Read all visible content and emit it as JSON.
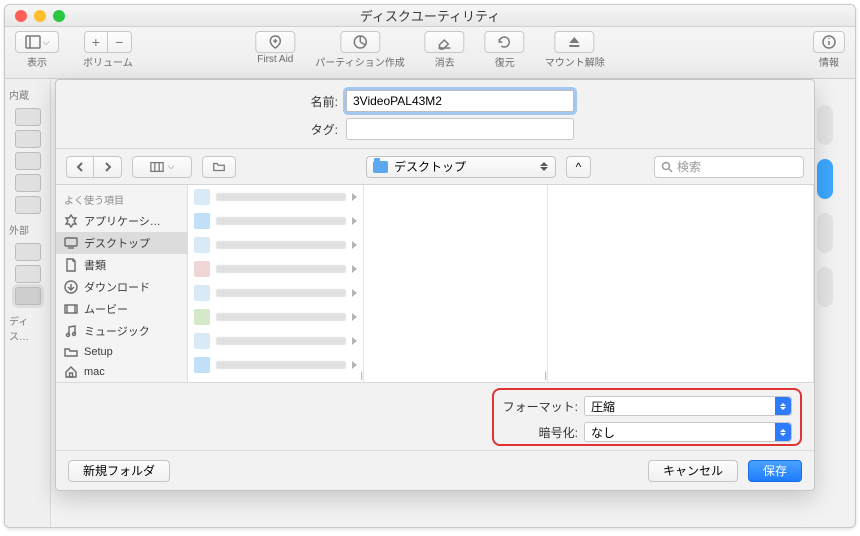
{
  "titlebar": {
    "title": "ディスクユーティリティ"
  },
  "toolbar": {
    "view_label": "表示",
    "volume_label": "ボリューム",
    "first_aid": "First Aid",
    "partition": "パーティション作成",
    "erase": "消去",
    "restore": "復元",
    "unmount": "マウント解除",
    "info": "情報"
  },
  "bg_sidebar": {
    "internal": "内蔵",
    "external": "外部",
    "disk_images": "ディス…"
  },
  "sheet": {
    "name_label": "名前:",
    "name_value": "3VideoPAL43M2",
    "tag_label": "タグ:"
  },
  "nav": {
    "location": "デスクトップ",
    "collapse": "^",
    "search_placeholder": "検索"
  },
  "favorites": {
    "heading": "よく使う項目",
    "items": [
      {
        "label": "アプリケーシ…",
        "icon": "apps"
      },
      {
        "label": "デスクトップ",
        "icon": "desktop",
        "selected": true
      },
      {
        "label": "書類",
        "icon": "doc"
      },
      {
        "label": "ダウンロード",
        "icon": "download"
      },
      {
        "label": "ムービー",
        "icon": "movie"
      },
      {
        "label": "ミュージック",
        "icon": "music"
      },
      {
        "label": "Setup",
        "icon": "folder"
      },
      {
        "label": "mac",
        "icon": "home"
      }
    ]
  },
  "format": {
    "format_label": "フォーマット:",
    "format_value": "圧縮",
    "encrypt_label": "暗号化:",
    "encrypt_value": "なし"
  },
  "buttons": {
    "new_folder": "新規フォルダ",
    "cancel": "キャンセル",
    "save": "保存"
  }
}
